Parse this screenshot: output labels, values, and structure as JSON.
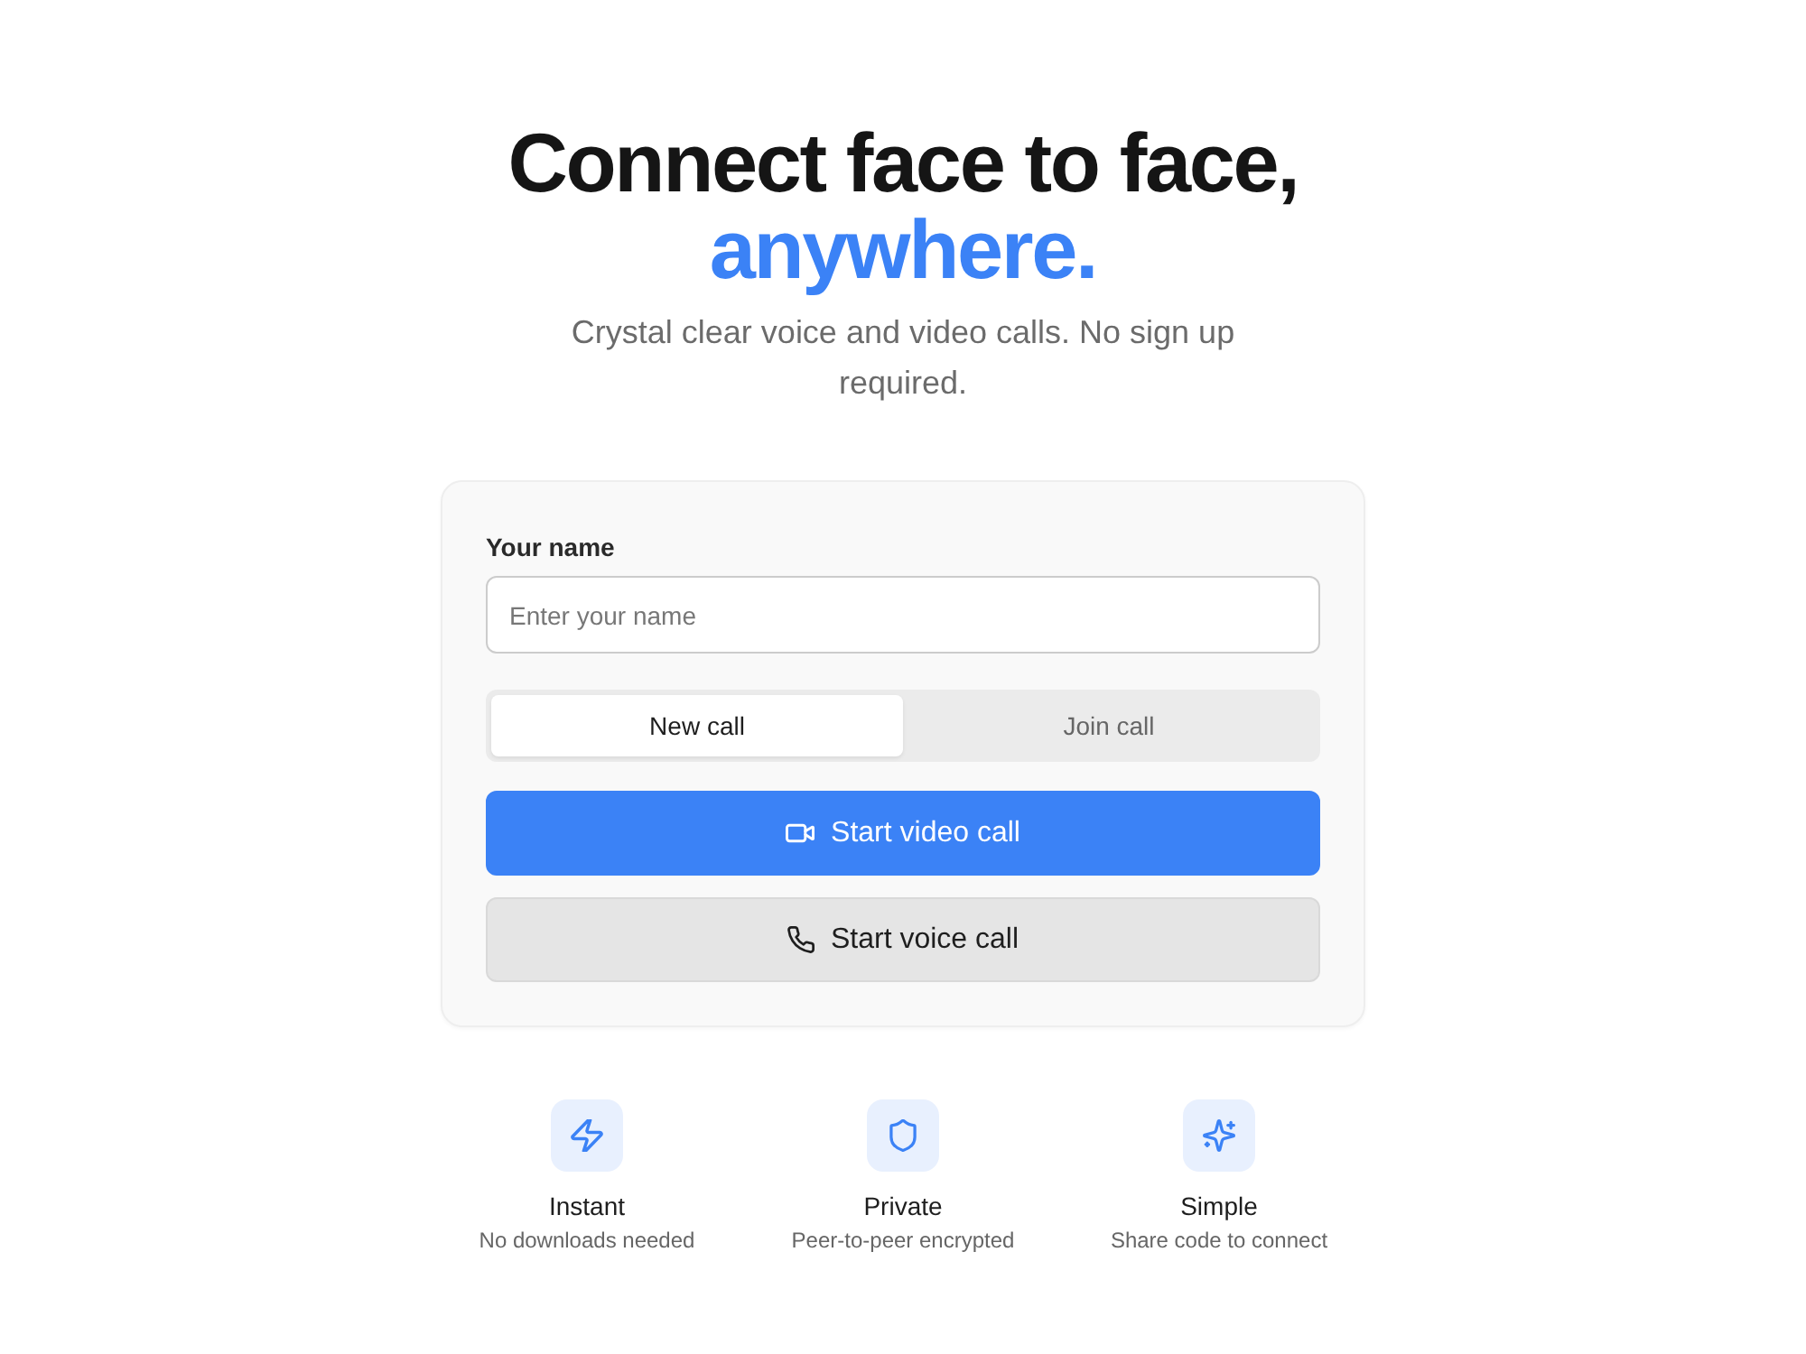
{
  "hero": {
    "title": "Connect face to face,",
    "title_accent": "anywhere.",
    "subtitle": "Crystal clear voice and video calls. No sign up required."
  },
  "form": {
    "name_field": {
      "label": "Your name",
      "placeholder": "Enter your name"
    },
    "tabs": [
      {
        "label": "New call",
        "selected": true
      },
      {
        "label": "Join call",
        "selected": false
      }
    ],
    "actions": [
      {
        "kind": "video",
        "label": "Start video call"
      },
      {
        "kind": "voice",
        "label": "Start voice call"
      }
    ]
  },
  "features": [
    {
      "kind": "instant",
      "title": "Instant",
      "description": "No downloads needed"
    },
    {
      "kind": "private",
      "title": "Private",
      "description": "Peer-to-peer encrypted"
    },
    {
      "kind": "simple",
      "title": "Simple",
      "description": "Share code to connect"
    }
  ]
}
